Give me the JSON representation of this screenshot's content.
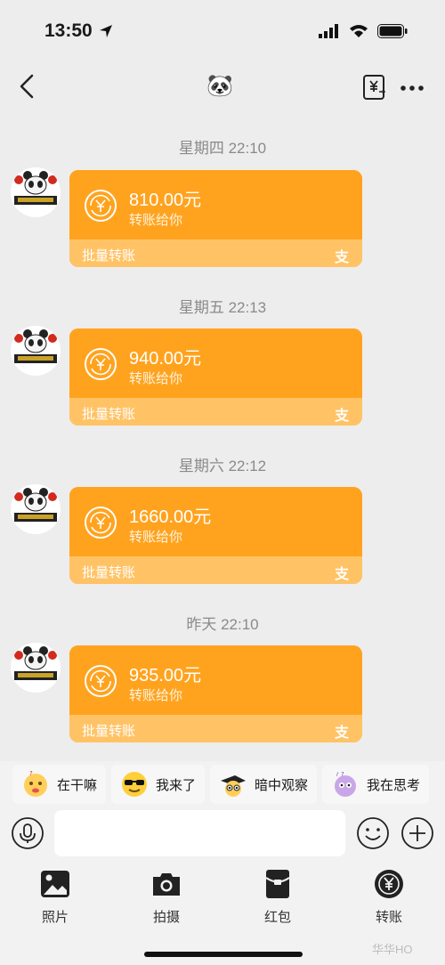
{
  "status_bar": {
    "time": "13:50"
  },
  "nav": {
    "title": "🐼"
  },
  "messages": [
    {
      "time": "星期四 22:10",
      "amount": "810.00元",
      "subtitle": "转账给你",
      "footer": "批量转账",
      "badge": "支"
    },
    {
      "time": "星期五 22:13",
      "amount": "940.00元",
      "subtitle": "转账给你",
      "footer": "批量转账",
      "badge": "支"
    },
    {
      "time": "星期六 22:12",
      "amount": "1660.00元",
      "subtitle": "转账给你",
      "footer": "批量转账",
      "badge": "支"
    },
    {
      "time": "昨天 22:10",
      "amount": "935.00元",
      "subtitle": "转账给你",
      "footer": "批量转账",
      "badge": "支"
    }
  ],
  "quick_replies": [
    {
      "label": "在干嘛",
      "icon": "thinking-emoji-icon"
    },
    {
      "label": "我来了",
      "icon": "sunglasses-emoji-icon"
    },
    {
      "label": "暗中观察",
      "icon": "peeking-emoji-icon"
    },
    {
      "label": "我在思考",
      "icon": "pondering-emoji-icon"
    }
  ],
  "input": {
    "placeholder": ""
  },
  "panel": [
    {
      "label": "照片",
      "icon": "image-icon"
    },
    {
      "label": "拍摄",
      "icon": "camera-icon"
    },
    {
      "label": "红包",
      "icon": "red-packet-icon"
    },
    {
      "label": "转账",
      "icon": "transfer-icon"
    }
  ],
  "watermark": "华华HO",
  "colors": {
    "card": "#ffa31f",
    "card_footer": "#ffc366",
    "background": "#ededed"
  }
}
